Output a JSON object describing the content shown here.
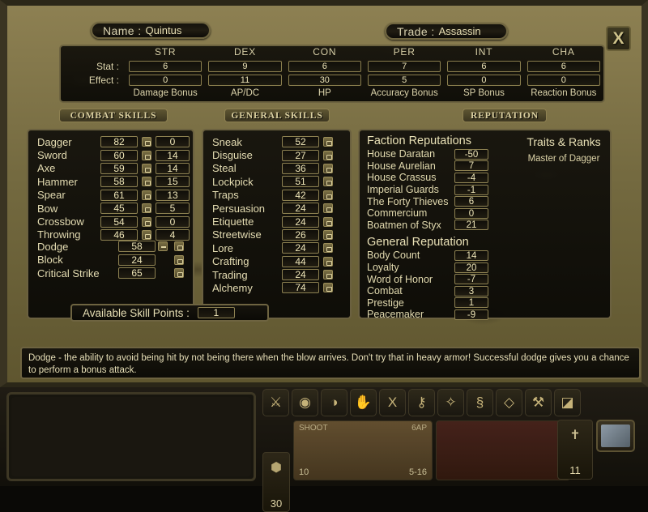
{
  "header": {
    "name_label": "Name :",
    "name_value": "Quintus",
    "trade_label": "Trade :",
    "trade_value": "Assassin",
    "close_label": "X"
  },
  "stats": {
    "row_labels": [
      "Stat :",
      "Effect :"
    ],
    "columns": [
      "STR",
      "DEX",
      "CON",
      "PER",
      "INT",
      "CHA"
    ],
    "stat_values": [
      "6",
      "9",
      "6",
      "7",
      "6",
      "6"
    ],
    "effect_values": [
      "0",
      "11",
      "30",
      "5",
      "0",
      "0"
    ],
    "effect_labels": [
      "Damage Bonus",
      "AP/DC",
      "HP",
      "Accuracy Bonus",
      "SP Bonus",
      "Reaction Bonus"
    ]
  },
  "tabs": [
    {
      "id": "combat",
      "label": "COMBAT SKILLS"
    },
    {
      "id": "general",
      "label": "GENERAL SKILLS"
    },
    {
      "id": "reputation",
      "label": "REPUTATION"
    }
  ],
  "combat_skills": [
    {
      "name": "Dagger",
      "value": "82",
      "bonus": "0"
    },
    {
      "name": "Sword",
      "value": "60",
      "bonus": "14"
    },
    {
      "name": "Axe",
      "value": "59",
      "bonus": "14"
    },
    {
      "name": "Hammer",
      "value": "58",
      "bonus": "15"
    },
    {
      "name": "Spear",
      "value": "61",
      "bonus": "13"
    },
    {
      "name": "Bow",
      "value": "45",
      "bonus": "5"
    },
    {
      "name": "Crossbow",
      "value": "54",
      "bonus": "0"
    },
    {
      "name": "Throwing",
      "value": "46",
      "bonus": "4"
    }
  ],
  "defense_skills": [
    {
      "name": "Dodge",
      "value": "58",
      "has_minus": true
    },
    {
      "name": "Block",
      "value": "24",
      "has_minus": false
    },
    {
      "name": "Critical Strike",
      "value": "65",
      "has_minus": false
    }
  ],
  "general_skills": [
    {
      "name": "Sneak",
      "value": "52"
    },
    {
      "name": "Disguise",
      "value": "27"
    },
    {
      "name": "Steal",
      "value": "36"
    },
    {
      "name": "Lockpick",
      "value": "51"
    },
    {
      "name": "Traps",
      "value": "42"
    },
    {
      "name": "Persuasion",
      "value": "24"
    },
    {
      "name": "Etiquette",
      "value": "24"
    },
    {
      "name": "Streetwise",
      "value": "26"
    },
    {
      "name": "Lore",
      "value": "24"
    },
    {
      "name": "Crafting",
      "value": "44"
    },
    {
      "name": "Trading",
      "value": "24"
    },
    {
      "name": "Alchemy",
      "value": "74"
    }
  ],
  "faction_reputations": {
    "title": "Faction Reputations",
    "items": [
      {
        "name": "House Daratan",
        "value": "-50"
      },
      {
        "name": "House Aurelian",
        "value": "7"
      },
      {
        "name": "House Crassus",
        "value": "-4"
      },
      {
        "name": "Imperial Guards",
        "value": "-1"
      },
      {
        "name": "The Forty Thieves",
        "value": "6"
      },
      {
        "name": "Commercium",
        "value": "0"
      },
      {
        "name": "Boatmen of Styx",
        "value": "21"
      }
    ]
  },
  "general_reputation": {
    "title": "General Reputation",
    "items": [
      {
        "name": "Body Count",
        "value": "14"
      },
      {
        "name": "Loyalty",
        "value": "20"
      },
      {
        "name": "Word of Honor",
        "value": "-7"
      },
      {
        "name": "Combat",
        "value": "3"
      },
      {
        "name": "Prestige",
        "value": "1"
      },
      {
        "name": "Peacemaker",
        "value": "-9"
      }
    ]
  },
  "traits": {
    "title": "Traits & Ranks",
    "items": [
      "Master of Dagger"
    ]
  },
  "skill_points": {
    "label": "Available Skill Points :",
    "value": "1"
  },
  "tooltip": {
    "text": "Dodge - the ability to avoid being hit by not being there when the blow arrives. Don't try that in heavy armor! Successful dodge gives you a chance to perform a bonus attack."
  },
  "hud": {
    "action_icons": [
      {
        "name": "attack-icon",
        "glyph": "⚔"
      },
      {
        "name": "eye-icon",
        "glyph": "◉"
      },
      {
        "name": "talk-icon",
        "glyph": "◑"
      },
      {
        "name": "hand-icon",
        "glyph": "✋"
      },
      {
        "name": "sneak-icon",
        "glyph": "Х"
      },
      {
        "name": "lockpick-icon",
        "glyph": "⚷"
      },
      {
        "name": "trap-icon",
        "glyph": "✧"
      },
      {
        "name": "potion-icon",
        "glyph": "§"
      },
      {
        "name": "scroll-icon",
        "glyph": "◇"
      },
      {
        "name": "crafting-icon",
        "glyph": "⚒"
      },
      {
        "name": "inventory-icon",
        "glyph": "◪"
      }
    ],
    "action_points": "30",
    "weapon": {
      "mode_label": "SHOOT",
      "ap_cost": "6AP",
      "ammo": "10",
      "damage": "5-16"
    },
    "character_value": "11",
    "map_button_name": "map-button"
  },
  "colors": {
    "stone": "#7d7145",
    "panel_dark": "#14120c",
    "text_gold": "#e4dcb2",
    "border_gold": "#8d8151"
  }
}
